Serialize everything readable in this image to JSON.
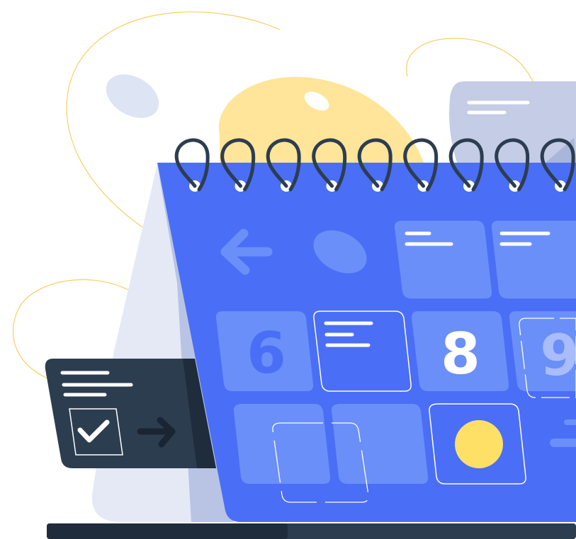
{
  "calendar": {
    "dates": {
      "six": "6",
      "eight": "8",
      "nine": "9"
    },
    "colors": {
      "page": "#4a6ef6",
      "tile": "#6a8ff8",
      "stand": "#dfe5f3",
      "yellow": "#fee599",
      "dot": "#ffe066",
      "dark": "#2d3d50",
      "back_card": "#c4cce6"
    },
    "rings": 9
  },
  "task_card": {
    "checkbox_state": "checked",
    "icons": [
      "check-icon",
      "arrow-right-icon"
    ]
  },
  "nav": {
    "icons": [
      "arrow-left-icon"
    ]
  }
}
